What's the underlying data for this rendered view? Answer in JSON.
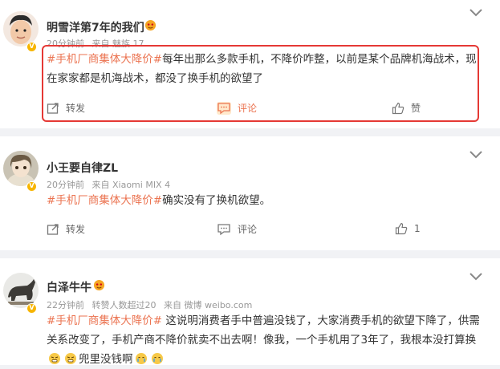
{
  "posts": [
    {
      "username": "明雪洋第7年的我们",
      "time": "20分钟前",
      "source": "来自 魅族 17",
      "hashtag": "#手机厂商集体大降价#",
      "text": "每年出那么多款手机，不降价咋整，以前是某个品牌机海战术，现在家家都是机海战术，都没了换手机的欲望了",
      "actions": {
        "repost": "转发",
        "comment": "评论",
        "like": "赞"
      }
    },
    {
      "username": "小王要自律ZL",
      "time": "20分钟前",
      "source": "来自 Xiaomi MIX 4",
      "hashtag": "#手机厂商集体大降价#",
      "text": "确实没有了换机欲望。",
      "actions": {
        "repost": "转发",
        "comment": "评论",
        "like": "1"
      }
    },
    {
      "username": "白泽牛牛",
      "time": "22分钟前",
      "reposts": "转赞人数超过20",
      "source": "来自 微博 weibo.com",
      "hashtag": "#手机厂商集体大降价#",
      "text": " 这说明消费者手中普遍没钱了，大家消费手机的欲望下降了，供需关系改变了，手机产商不降价就卖不出去啊！像我，一个手机用了3年了，我根本没打算换",
      "text_tail": "兜里没钱啊"
    }
  ],
  "colors": {
    "accent": "#eb7350",
    "highlight": "#e53935",
    "vip": "#f7b500"
  },
  "icons": [
    "chevron-down-icon",
    "repost-icon",
    "comment-icon",
    "like-icon",
    "vip-badge-icon",
    "emoji-icon"
  ]
}
